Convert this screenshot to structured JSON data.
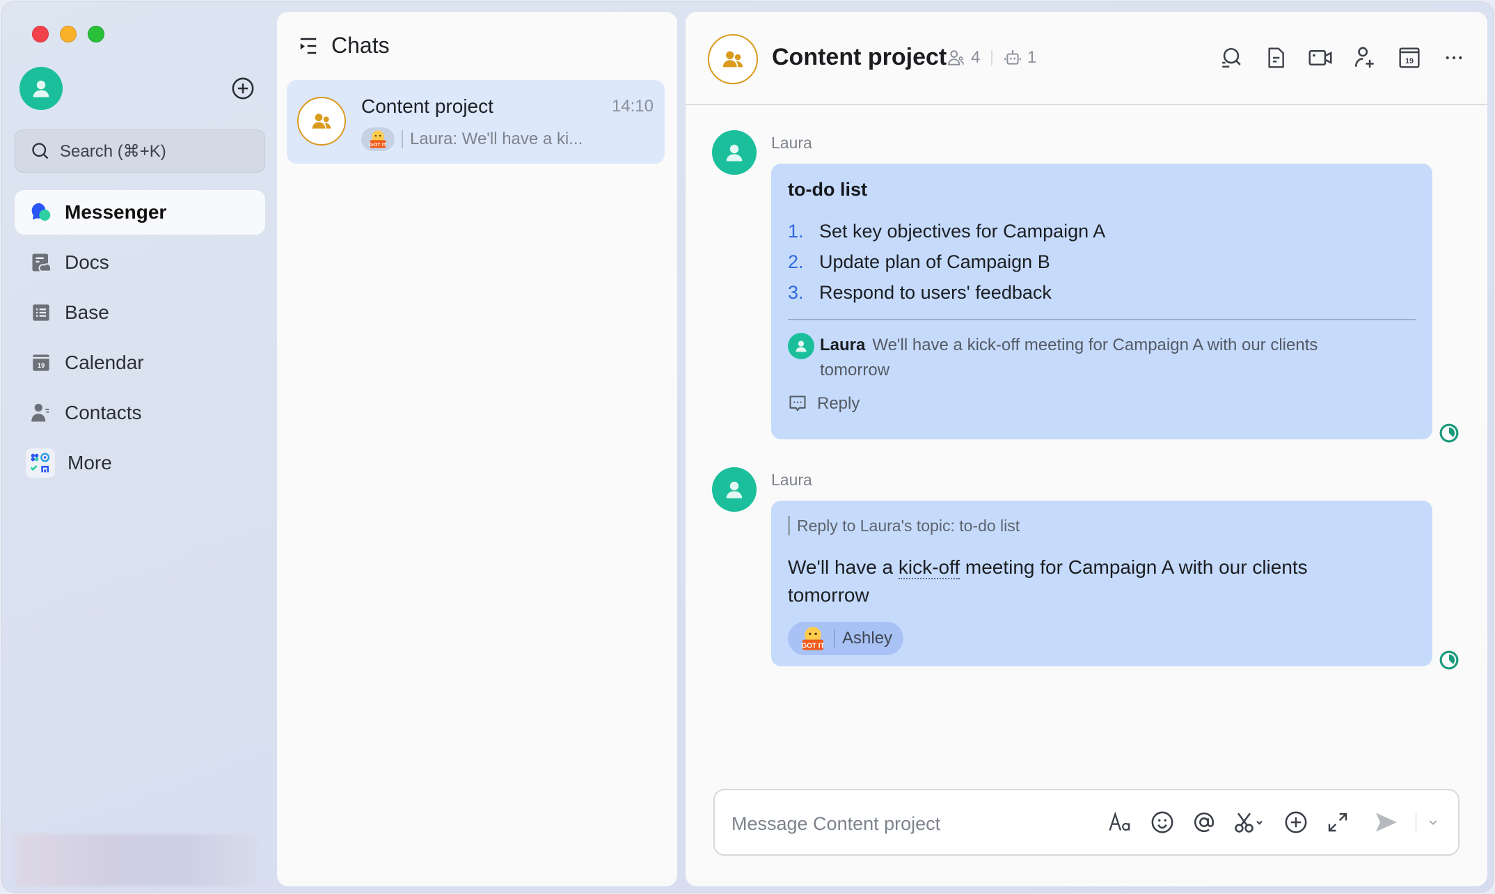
{
  "window": {
    "traffic_lights": [
      "close",
      "minimize",
      "maximize"
    ]
  },
  "sidebar": {
    "search": {
      "placeholder": "Search (⌘+K)",
      "icon": "search-icon"
    },
    "new_button_icon": "plus-circle-icon",
    "items": [
      {
        "label": "Messenger",
        "icon": "messenger-icon",
        "active": true
      },
      {
        "label": "Docs",
        "icon": "docs-icon",
        "active": false
      },
      {
        "label": "Base",
        "icon": "base-icon",
        "active": false
      },
      {
        "label": "Calendar",
        "icon": "calendar-icon",
        "active": false,
        "badge": "19"
      },
      {
        "label": "Contacts",
        "icon": "contacts-icon",
        "active": false
      },
      {
        "label": "More",
        "icon": "more-apps-icon",
        "active": false
      }
    ]
  },
  "chat_list": {
    "title": "Chats",
    "items": [
      {
        "name": "Content project",
        "time": "14:10",
        "sticker": "GOT IT",
        "preview": "Laura: We'll have a ki..."
      }
    ]
  },
  "chat": {
    "title": "Content project",
    "member_count": "4",
    "bot_count": "1",
    "actions": [
      "search-history",
      "docs",
      "video-call",
      "add-member",
      "calendar",
      "more"
    ],
    "calendar_day": "19",
    "messages": [
      {
        "sender": "Laura",
        "title": "to-do list",
        "items": [
          {
            "num": "1.",
            "text": "Set key objectives for Campaign A"
          },
          {
            "num": "2.",
            "text": "Update plan of Campaign B"
          },
          {
            "num": "3.",
            "text": "Respond to users' feedback"
          }
        ],
        "thread_reply": {
          "sender": "Laura",
          "text": "We'll have a kick-off meeting for Campaign A with our clients tomorrow"
        },
        "reply_label": "Reply"
      },
      {
        "sender": "Laura",
        "reply_to": "Reply to Laura's topic:  to-do list",
        "text_before": "We'll have a ",
        "text_highlight": "kick-off",
        "text_after": " meeting for Campaign A with our clients tomorrow",
        "reaction": {
          "sticker": "GOT IT",
          "user": "Ashley"
        }
      }
    ],
    "composer": {
      "placeholder": "Message Content project",
      "value": ""
    }
  },
  "colors": {
    "accent_green": "#1bbf9c",
    "bubble_blue": "#c6dbfc",
    "group_gold": "#d99a1d",
    "list_number_blue": "#2f6ae0"
  }
}
